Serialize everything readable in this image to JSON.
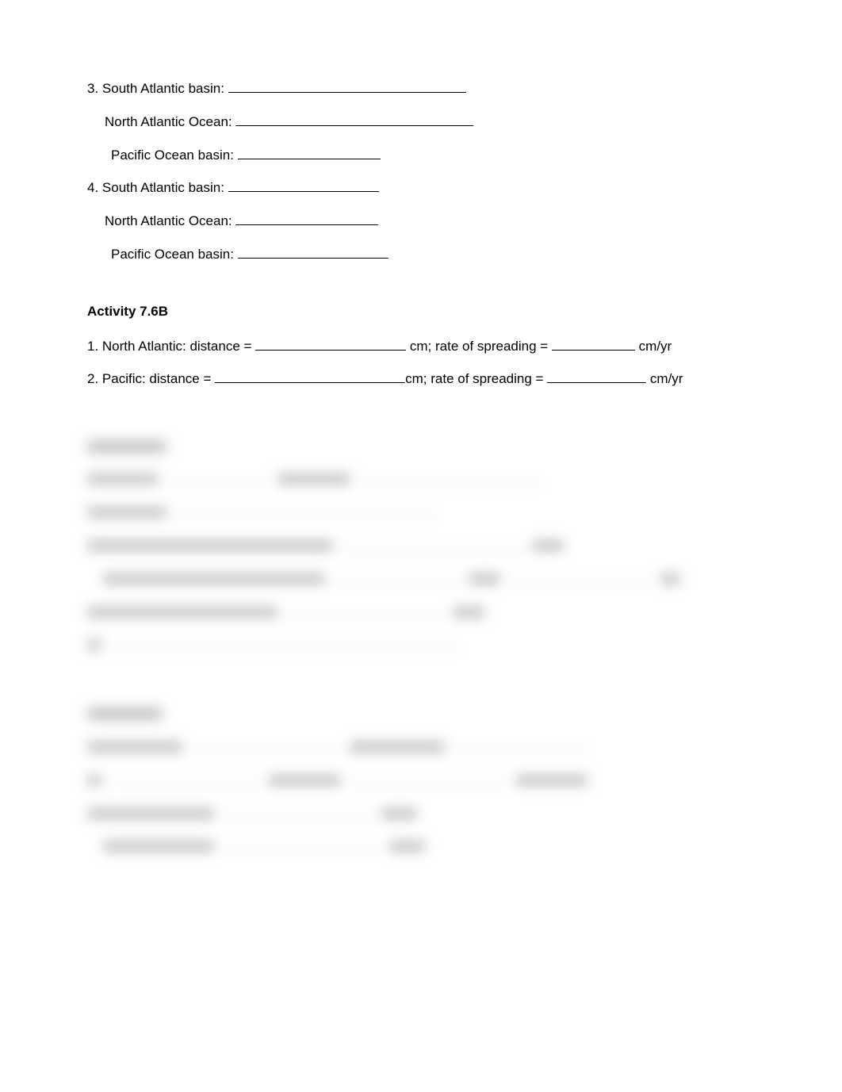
{
  "q3": {
    "prefix": "3. South Atlantic basin: ",
    "sub1": "North Atlantic Ocean: ",
    "sub2": "Pacific Ocean basin: "
  },
  "q4": {
    "prefix": "4. South Atlantic basin: ",
    "sub1": "North Atlantic Ocean: ",
    "sub2": "Pacific Ocean basin: "
  },
  "activity_heading": "Activity 7.6B",
  "b1": {
    "prefix": "1. North Atlantic: distance = ",
    "mid": " cm; rate of spreading = ",
    "suffix": " cm/yr"
  },
  "b2": {
    "prefix": "2. Pacific: distance = ",
    "mid": "cm; rate of spreading = ",
    "suffix": " cm/yr"
  }
}
